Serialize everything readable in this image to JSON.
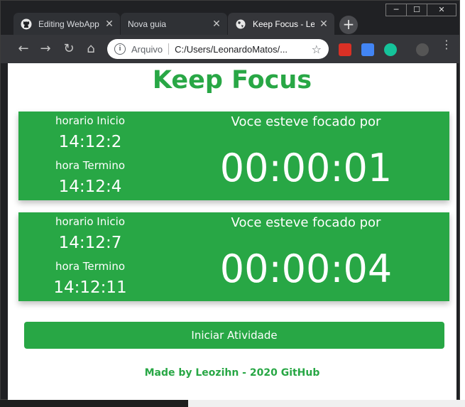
{
  "browser": {
    "tabs": [
      {
        "title": "Editing WebApp",
        "icon": "github-icon"
      },
      {
        "title": "Nova guia",
        "icon": ""
      },
      {
        "title": "Keep Focus - Le",
        "icon": "globe-icon"
      }
    ],
    "address": {
      "scheme_label": "Arquivo",
      "url": "C:/Users/LeonardoMatos/..."
    }
  },
  "app": {
    "title": "Keep Focus",
    "sessions": [
      {
        "start_label": "horario Inicio",
        "start_time": "14:12:2",
        "end_label": "hora Termino",
        "end_time": "14:12:4",
        "focus_label": "Voce esteve focado por",
        "focus_duration": "00:00:01"
      },
      {
        "start_label": "horario Inicio",
        "start_time": "14:12:7",
        "end_label": "hora Termino",
        "end_time": "14:12:11",
        "focus_label": "Voce esteve focado por",
        "focus_duration": "00:00:04"
      }
    ],
    "start_button": "Iniciar Atividade",
    "footer": "Made by Leozihn - 2020 GitHub"
  },
  "colors": {
    "accent": "#28a745",
    "chrome_dark": "#202124",
    "chrome_tab": "#35363a"
  }
}
